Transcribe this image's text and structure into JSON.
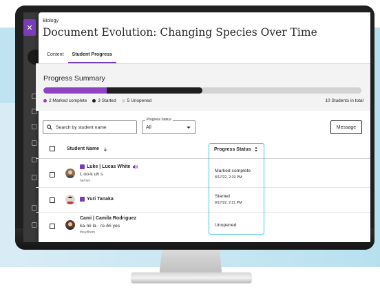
{
  "colors": {
    "accent": "#7a3db8",
    "complete": "#8e44c2",
    "started": "#1f1f1f",
    "unopened": "#d3d3d3",
    "highlight": "#3ec5d8"
  },
  "header": {
    "breadcrumb": "Biology",
    "title": "Document Evolution: Changing Species Over Time",
    "close_icon": "close-icon"
  },
  "tabs": [
    {
      "label": "Content",
      "active": false
    },
    {
      "label": "Student Progress",
      "active": true
    }
  ],
  "summary": {
    "title": "Progress Summary",
    "marked_complete": 2,
    "started": 3,
    "unopened": 5,
    "total": 10,
    "legend": {
      "complete": "2 Marked complete",
      "started": "3 Started",
      "unopened": "5 Unopened"
    },
    "total_label": "10 Students in total"
  },
  "toolbar": {
    "search_placeholder": "Search by student name",
    "filter_label": "Progress Status",
    "filter_value": "All",
    "message_label": "Message"
  },
  "table": {
    "col_name": "Student Name",
    "col_status": "Progress Status",
    "rows": [
      {
        "name": "Luke | Lucas White",
        "phonetic": "L oo-k uh s",
        "pronouns": "he/him",
        "status": "Marked complete",
        "date": "8/17/22, 2:19 PM"
      },
      {
        "name": "Yuri Tanaka",
        "phonetic": "",
        "pronouns": "",
        "status": "Started",
        "date": "8/17/22, 2:21 PM"
      },
      {
        "name": "Cami | Camila Rodriguez",
        "phonetic": "ka·mi la - ro·ðri yes",
        "pronouns": "they/them",
        "status": "Unopened",
        "date": ""
      }
    ]
  }
}
